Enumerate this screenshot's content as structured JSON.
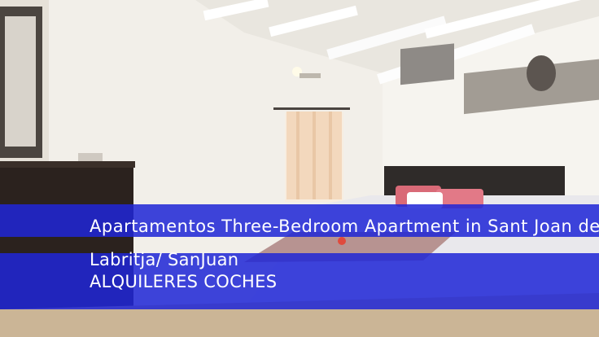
{
  "listing": {
    "title": "Apartamentos Three-Bedroom Apartment in Sant Joan de Labritja",
    "location": "Labritja/ SanJuan",
    "cta": "ALQUILERES COCHES"
  },
  "colors": {
    "banner": "#1f26d6",
    "text": "#ffffff"
  }
}
